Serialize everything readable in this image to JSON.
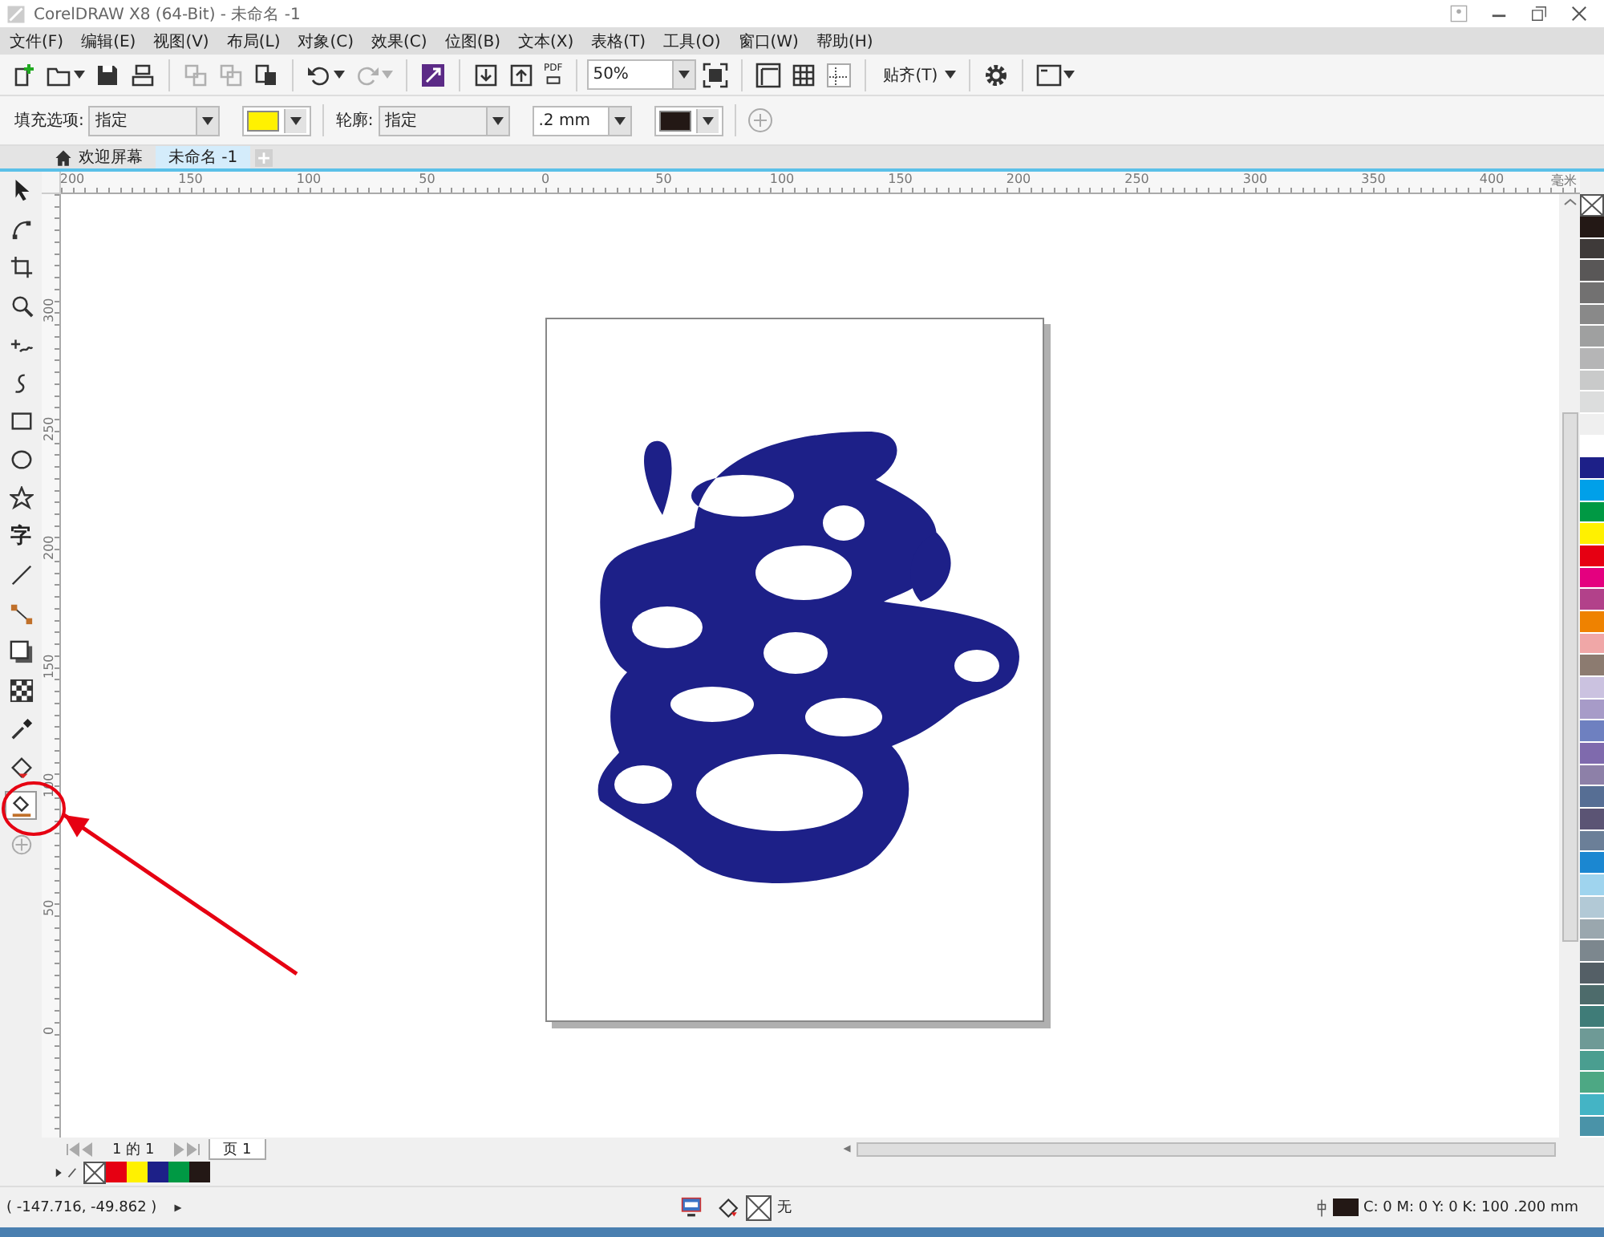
{
  "window": {
    "title": "CorelDRAW X8 (64-Bit) - 未命名 -1"
  },
  "menu": [
    {
      "label": "文件(F)"
    },
    {
      "label": "编辑(E)"
    },
    {
      "label": "视图(V)"
    },
    {
      "label": "布局(L)"
    },
    {
      "label": "对象(C)"
    },
    {
      "label": "效果(C)"
    },
    {
      "label": "位图(B)"
    },
    {
      "label": "文本(X)"
    },
    {
      "label": "表格(T)"
    },
    {
      "label": "工具(O)"
    },
    {
      "label": "窗口(W)"
    },
    {
      "label": "帮助(H)"
    }
  ],
  "toolbar": [
    {
      "kind": "new",
      "disabled": false,
      "dropdown": false
    },
    {
      "kind": "open",
      "disabled": false,
      "dropdown": true
    },
    {
      "kind": "save",
      "disabled": false,
      "dropdown": false
    },
    {
      "kind": "print",
      "disabled": false,
      "dropdown": false
    },
    {
      "kind": "separator"
    },
    {
      "kind": "cut",
      "disabled": true,
      "dropdown": false
    },
    {
      "kind": "copy",
      "disabled": true,
      "dropdown": false
    },
    {
      "kind": "paste",
      "disabled": false,
      "dropdown": false
    },
    {
      "kind": "separator"
    },
    {
      "kind": "undo",
      "disabled": false,
      "dropdown": true
    },
    {
      "kind": "redo",
      "disabled": true,
      "dropdown": true
    },
    {
      "kind": "separator"
    },
    {
      "kind": "launcher",
      "disabled": false,
      "dropdown": false
    },
    {
      "kind": "separator"
    },
    {
      "kind": "import",
      "disabled": false,
      "dropdown": false
    },
    {
      "kind": "export",
      "disabled": false,
      "dropdown": false
    },
    {
      "kind": "pdf",
      "label": "PDF",
      "disabled": false,
      "dropdown": false
    },
    {
      "kind": "separator"
    },
    {
      "kind": "combo",
      "value": "50%"
    },
    {
      "kind": "fullscreen",
      "disabled": false,
      "dropdown": false
    },
    {
      "kind": "separator"
    },
    {
      "kind": "rulers",
      "disabled": false,
      "dropdown": false
    },
    {
      "kind": "grid",
      "disabled": false,
      "dropdown": false
    },
    {
      "kind": "guidelines",
      "disabled": false,
      "dropdown": false
    },
    {
      "kind": "separator"
    },
    {
      "kind": "text-button",
      "label": "贴齐(T)",
      "dropdown": true
    },
    {
      "kind": "separator"
    },
    {
      "kind": "gear",
      "disabled": false,
      "dropdown": false
    },
    {
      "kind": "separator"
    },
    {
      "kind": "window",
      "disabled": false,
      "dropdown": true
    }
  ],
  "property_bar": {
    "fill_label": "填充选项:",
    "fill_mode": "指定",
    "fill_swatch": {
      "color": "#fff100"
    },
    "outline_label": "轮廓:",
    "outline_mode": "指定",
    "outline_width": ".2 mm",
    "outline_swatch": {
      "color": "#231815"
    }
  },
  "document_tabs": [
    {
      "kind": "home",
      "label": "欢迎屏幕",
      "selected": false
    },
    {
      "kind": "document",
      "label": "未命名 -1",
      "selected": true
    }
  ],
  "toolbox": [
    {
      "kind": "pointer",
      "selected": false
    },
    {
      "kind": "shape",
      "selected": false
    },
    {
      "kind": "crop",
      "selected": false
    },
    {
      "kind": "zoom",
      "selected": false
    },
    {
      "kind": "freehand",
      "selected": false
    },
    {
      "kind": "curve",
      "selected": false
    },
    {
      "kind": "rectangle",
      "selected": false
    },
    {
      "kind": "ellipse",
      "selected": false
    },
    {
      "kind": "star",
      "selected": false
    },
    {
      "kind": "text",
      "label": "字",
      "selected": false
    },
    {
      "kind": "line",
      "selected": false
    },
    {
      "kind": "connector",
      "selected": false
    },
    {
      "kind": "shadow",
      "selected": false
    },
    {
      "kind": "transparency",
      "selected": false
    },
    {
      "kind": "eyedropper",
      "selected": false
    },
    {
      "kind": "fill",
      "selected": false
    },
    {
      "kind": "smart-fill",
      "selected": true
    },
    {
      "kind": "add",
      "selected": false
    }
  ],
  "ruler_top": {
    "labels": [
      "200",
      "150",
      "100",
      "50",
      "0",
      "50",
      "100",
      "150",
      "200",
      "250",
      "300",
      "350",
      "400"
    ],
    "unit": "毫米"
  },
  "ruler_left": {
    "labels": [
      "300",
      "250",
      "200",
      "150",
      "100",
      "50",
      "0"
    ]
  },
  "page_nav": {
    "position": "1 的 1",
    "page_tab": "页 1"
  },
  "document_palette": [
    {
      "kind": "none"
    },
    {
      "kind": "swatch",
      "color": "#e60012"
    },
    {
      "kind": "swatch",
      "color": "#fff100"
    },
    {
      "kind": "swatch",
      "color": "#1d2088"
    },
    {
      "kind": "swatch",
      "color": "#009944"
    },
    {
      "kind": "swatch",
      "color": "#231815"
    }
  ],
  "color_palette": [
    {
      "kind": "none"
    },
    {
      "kind": "swatch",
      "color": "#231815"
    },
    {
      "kind": "swatch",
      "color": "#3e3a39"
    },
    {
      "kind": "swatch",
      "color": "#595757"
    },
    {
      "kind": "swatch",
      "color": "#727171"
    },
    {
      "kind": "swatch",
      "color": "#898989"
    },
    {
      "kind": "swatch",
      "color": "#9fa0a0"
    },
    {
      "kind": "swatch",
      "color": "#b5b5b6"
    },
    {
      "kind": "swatch",
      "color": "#c9caca"
    },
    {
      "kind": "swatch",
      "color": "#dcdddd"
    },
    {
      "kind": "swatch",
      "color": "#efefef"
    },
    {
      "kind": "swatch",
      "color": "#ffffff"
    },
    {
      "kind": "swatch",
      "color": "#1d2088"
    },
    {
      "kind": "swatch",
      "color": "#00a0e9"
    },
    {
      "kind": "swatch",
      "color": "#009944"
    },
    {
      "kind": "swatch",
      "color": "#fff100"
    },
    {
      "kind": "swatch",
      "color": "#e60012"
    },
    {
      "kind": "swatch",
      "color": "#e4007f"
    },
    {
      "kind": "swatch",
      "color": "#b2418a"
    },
    {
      "kind": "swatch",
      "color": "#ef8200"
    },
    {
      "kind": "swatch",
      "color": "#f0a7a7"
    },
    {
      "kind": "swatch",
      "color": "#8c7b70"
    },
    {
      "kind": "swatch",
      "color": "#cbc2e0"
    },
    {
      "kind": "swatch",
      "color": "#a79bc8"
    },
    {
      "kind": "swatch",
      "color": "#6e80c0"
    },
    {
      "kind": "swatch",
      "color": "#7f6aad"
    },
    {
      "kind": "swatch",
      "color": "#8d80a8"
    },
    {
      "kind": "swatch",
      "color": "#566e94"
    },
    {
      "kind": "swatch",
      "color": "#5b5474"
    },
    {
      "kind": "swatch",
      "color": "#6b7f98"
    },
    {
      "kind": "swatch",
      "color": "#1b87d1"
    },
    {
      "kind": "swatch",
      "color": "#9fd4ee"
    },
    {
      "kind": "swatch",
      "color": "#b2c9d6"
    },
    {
      "kind": "swatch",
      "color": "#9aa7ae"
    },
    {
      "kind": "swatch",
      "color": "#7c878e"
    },
    {
      "kind": "swatch",
      "color": "#545f66"
    },
    {
      "kind": "swatch",
      "color": "#4d6b6b"
    },
    {
      "kind": "swatch",
      "color": "#3f7c78"
    },
    {
      "kind": "swatch",
      "color": "#6e9a96"
    },
    {
      "kind": "swatch",
      "color": "#4a9e90"
    },
    {
      "kind": "swatch",
      "color": "#4da884"
    },
    {
      "kind": "swatch",
      "color": "#44b4c5"
    },
    {
      "kind": "swatch",
      "color": "#4a93a8"
    }
  ],
  "status_bar": {
    "coordinates": "( -147.716, -49.862 )",
    "fill_status": "无",
    "outline_status": "C: 0 M: 0 Y: 0 K: 100  .200 mm",
    "outline_swatch": {
      "color": "#231815"
    }
  },
  "annotation_marks": [
    {
      "kind": "circle"
    },
    {
      "kind": "arrow"
    }
  ]
}
